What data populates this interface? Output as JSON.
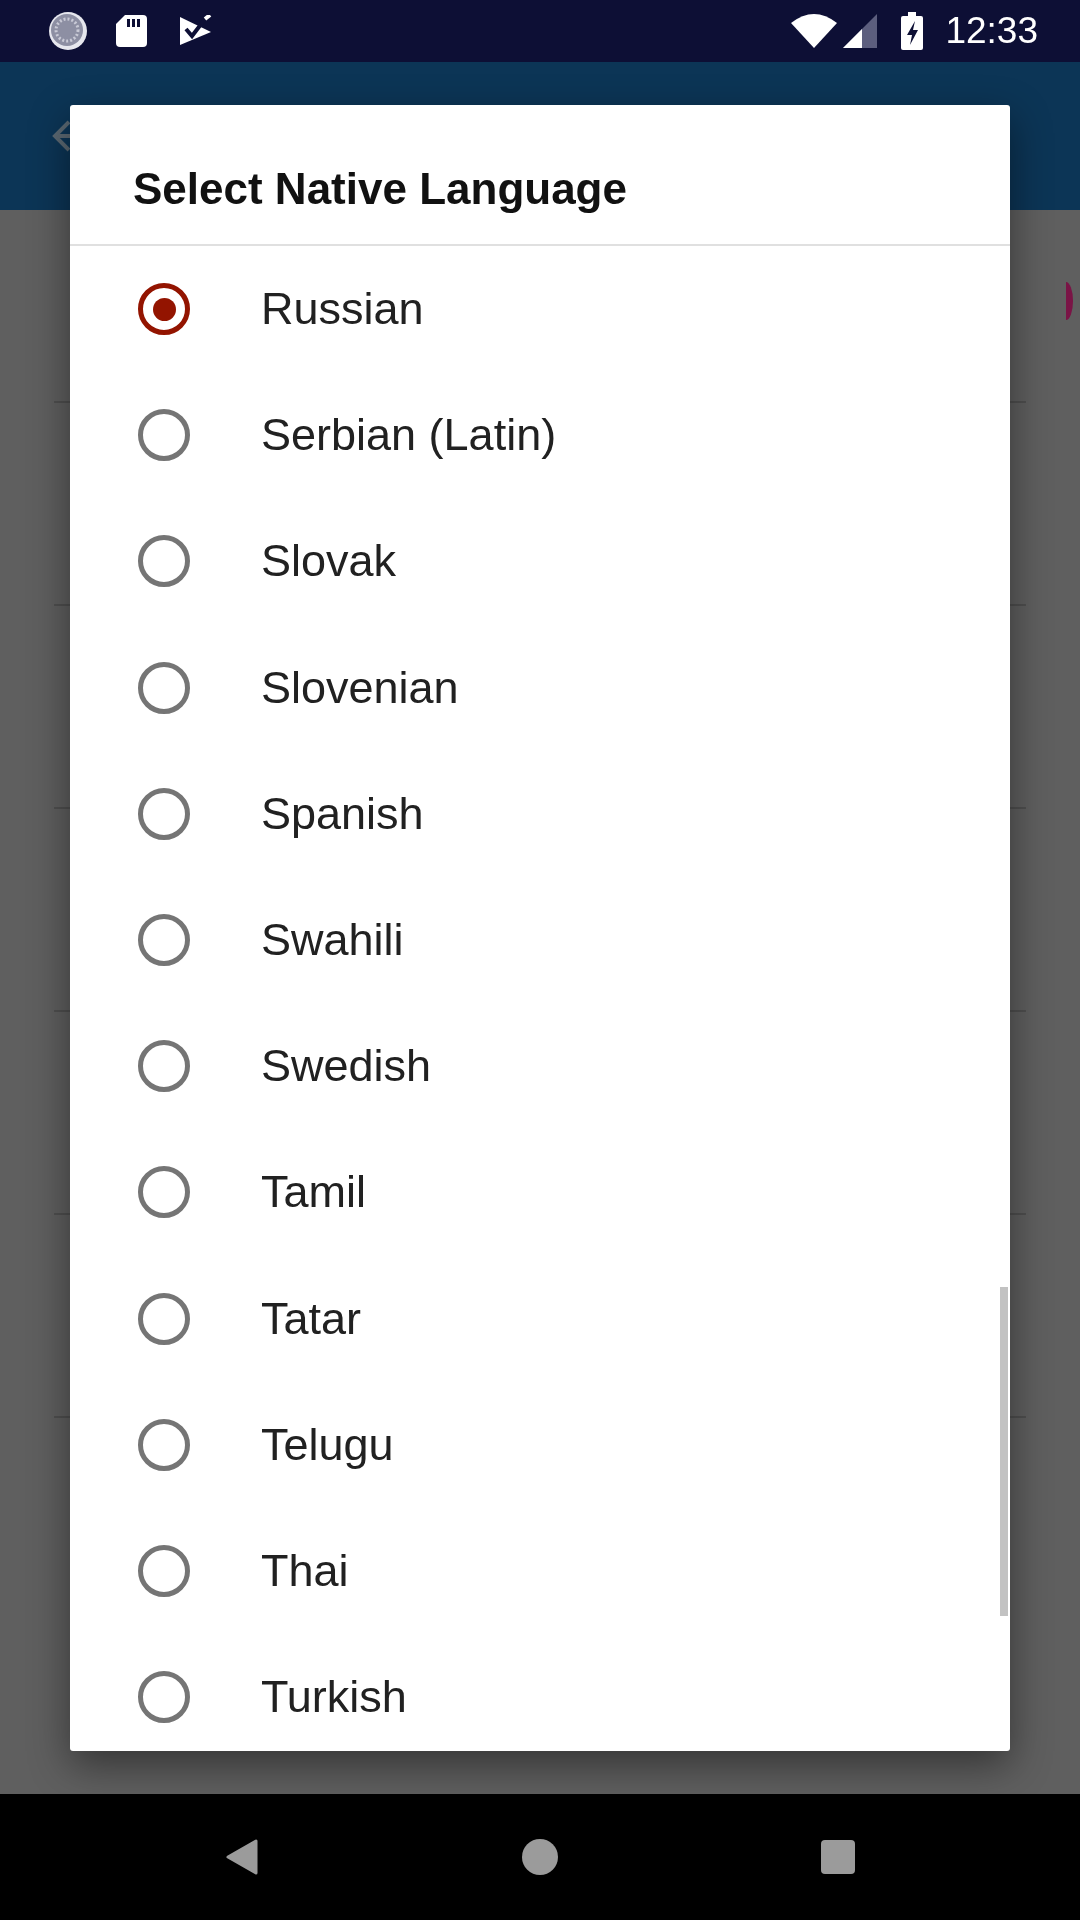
{
  "status_bar": {
    "time": "12:33"
  },
  "dialog": {
    "title": "Select Native Language",
    "options": [
      {
        "label": "Russian",
        "selected": true
      },
      {
        "label": "Serbian (Latin)",
        "selected": false
      },
      {
        "label": "Slovak",
        "selected": false
      },
      {
        "label": "Slovenian",
        "selected": false
      },
      {
        "label": "Spanish",
        "selected": false
      },
      {
        "label": "Swahili",
        "selected": false
      },
      {
        "label": "Swedish",
        "selected": false
      },
      {
        "label": "Tamil",
        "selected": false
      },
      {
        "label": "Tatar",
        "selected": false
      },
      {
        "label": "Telugu",
        "selected": false
      },
      {
        "label": "Thai",
        "selected": false
      },
      {
        "label": "Turkish",
        "selected": false
      }
    ]
  }
}
